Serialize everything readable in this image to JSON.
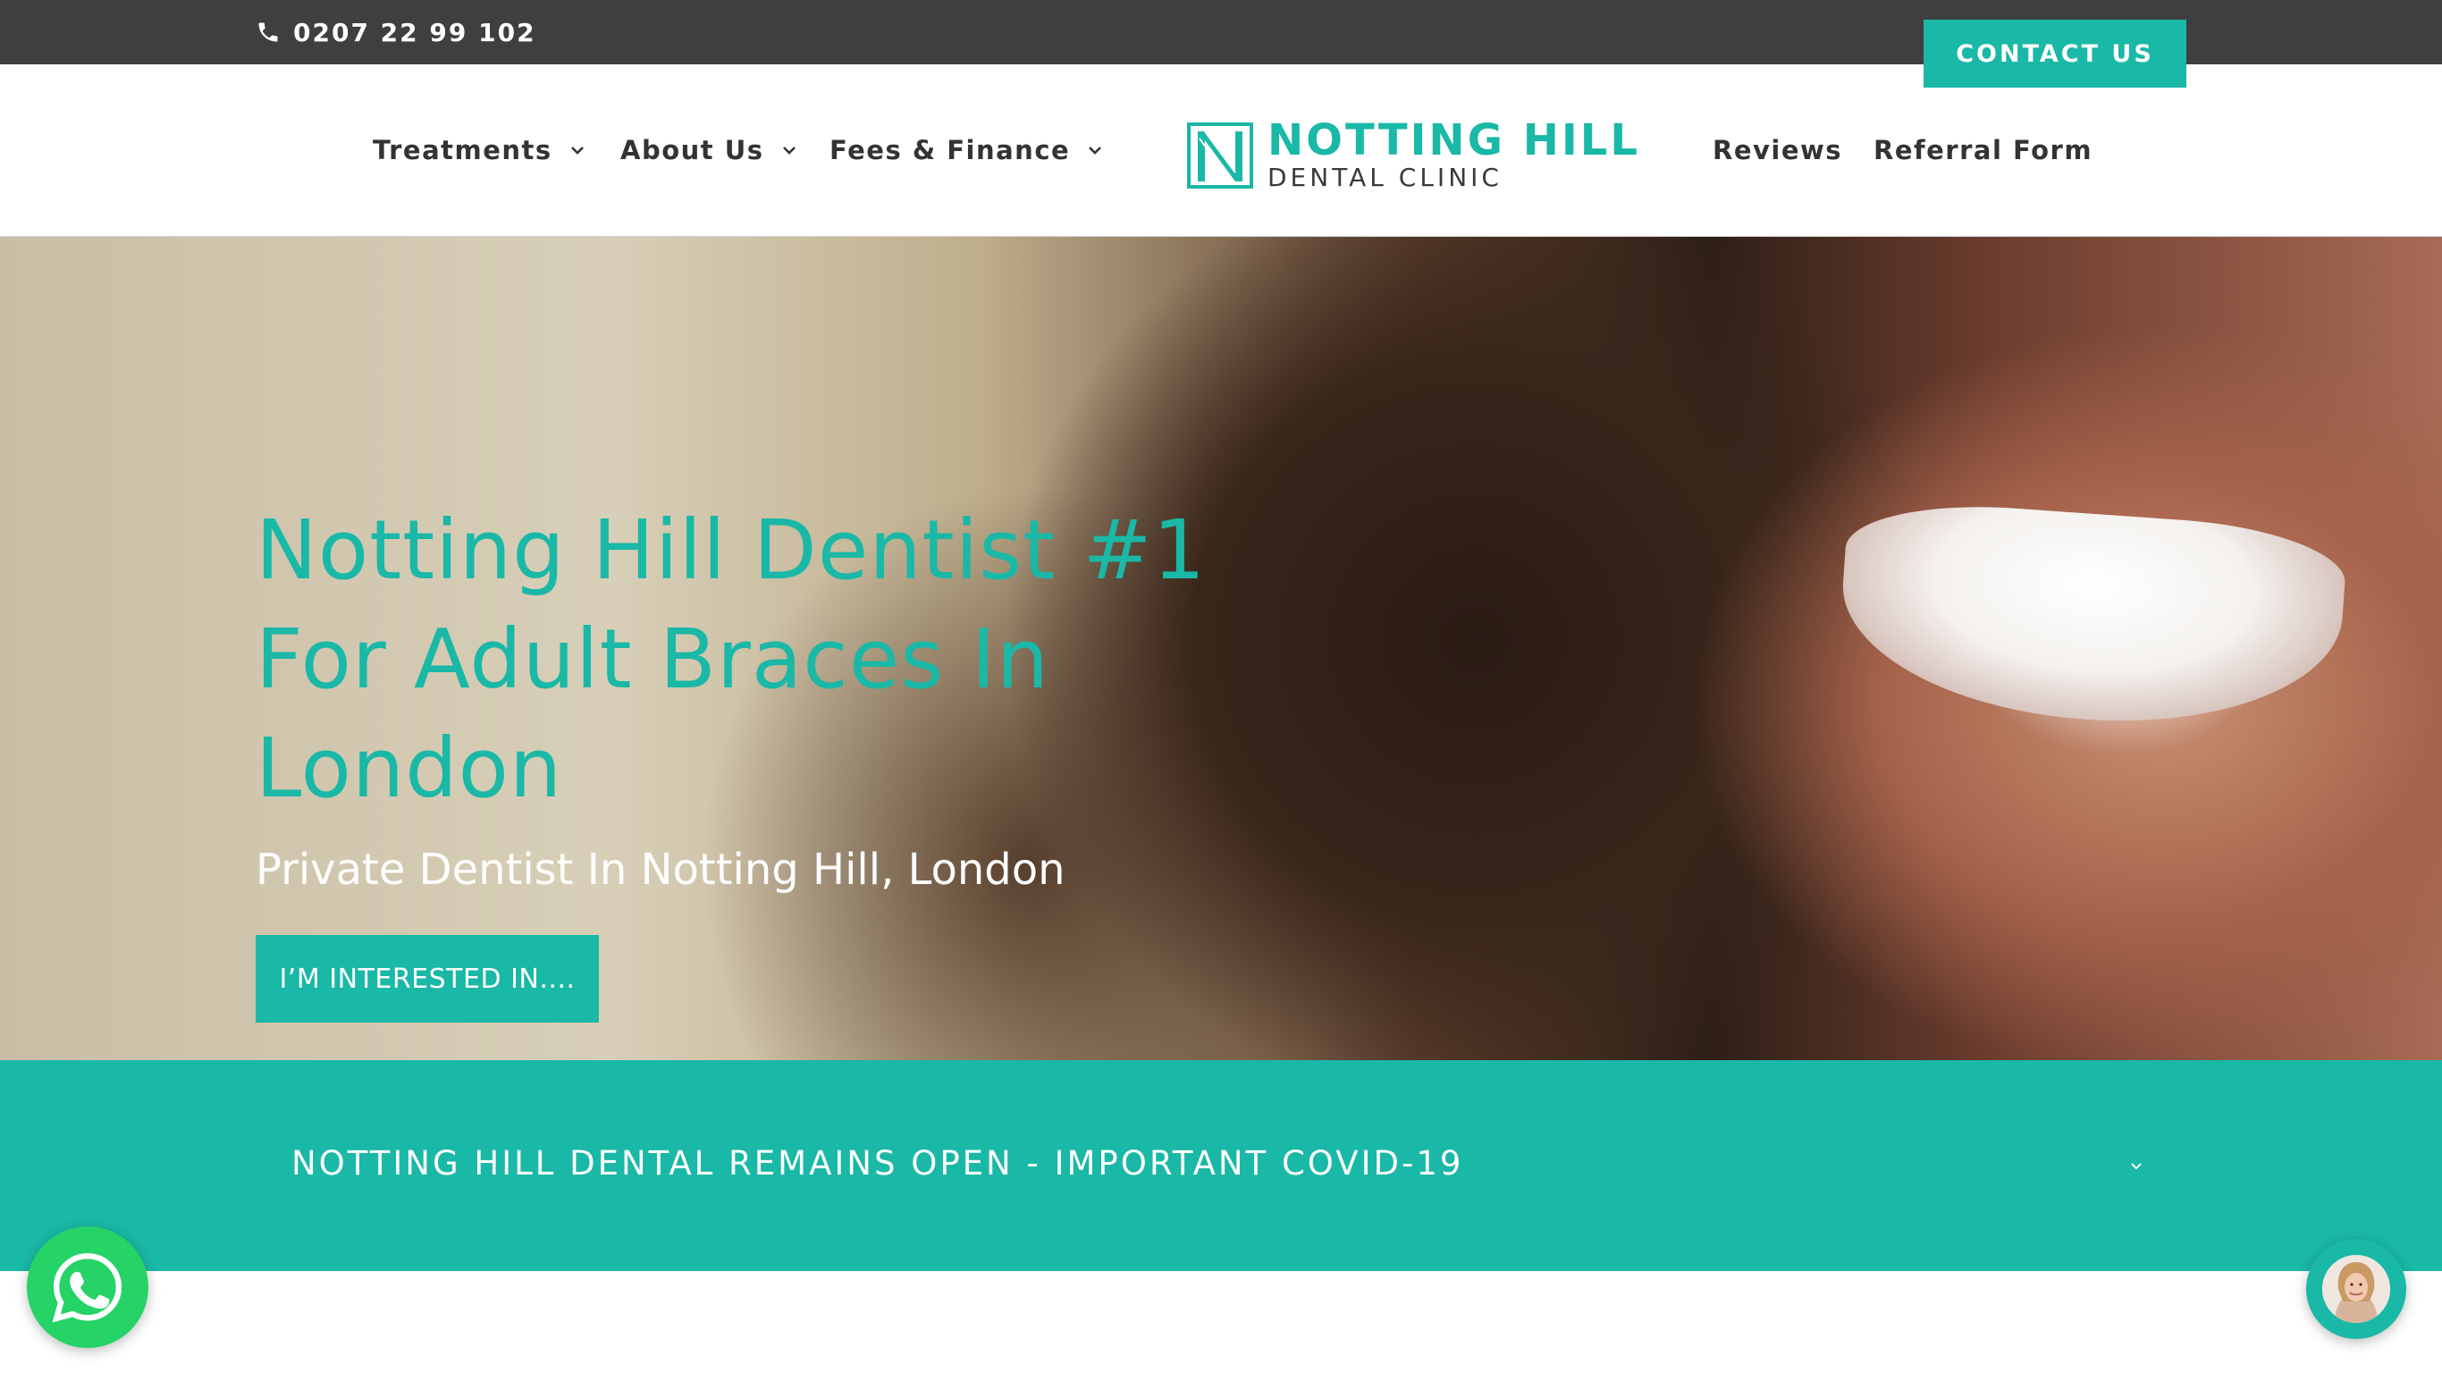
{
  "topbar": {
    "phone": "0207 22 99 102",
    "contact_button": "CONTACT US"
  },
  "nav": {
    "left": [
      {
        "label": "Treatments",
        "icon": "chevron-down-icon"
      },
      {
        "label": "About Us",
        "icon": "chevron-down-icon"
      },
      {
        "label": "Fees & Finance",
        "icon": "chevron-down-icon"
      }
    ],
    "right": [
      {
        "label": "Reviews"
      },
      {
        "label": "Referral Form"
      }
    ]
  },
  "logo": {
    "line1": "NOTTING HILL",
    "line2": "DENTAL CLINIC"
  },
  "hero": {
    "title_line1": "Notting Hill Dentist #1",
    "title_line2": "For Adult Braces In",
    "title_line3": "London",
    "subtitle": "Private Dentist In Notting Hill, London",
    "button": "I’M INTERESTED IN...."
  },
  "covid": {
    "text": "NOTTING HILL DENTAL REMAINS OPEN - IMPORTANT COVID-19",
    "icon": "chevron-down-icon"
  },
  "widgets": {
    "whatsapp_icon": "whatsapp-icon",
    "chat_icon": "chat-avatar-icon"
  },
  "colors": {
    "accent": "#1ab8a6",
    "topbar": "#3f3f3f",
    "nav_text": "#333333",
    "whatsapp": "#25d366"
  }
}
